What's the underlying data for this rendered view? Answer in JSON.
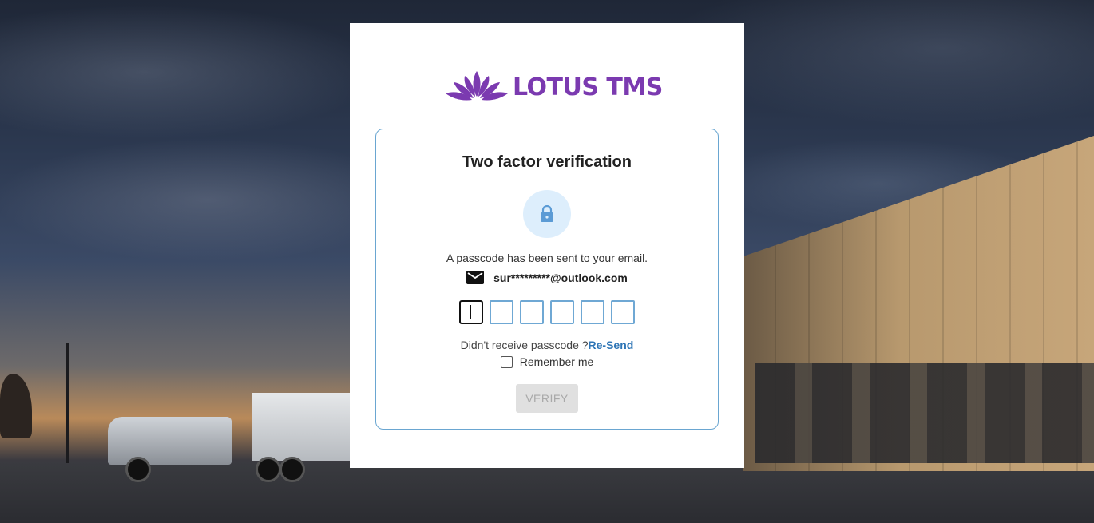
{
  "brand": {
    "name": "LOTUS TMS",
    "color": "#7b3ab0"
  },
  "verification": {
    "title": "Two factor verification",
    "message": "A passcode has been sent to your email.",
    "email": "sur*********@outlook.com",
    "code_digits": [
      "",
      "",
      "",
      "",
      "",
      ""
    ],
    "resend_prompt": "Didn't receive passcode ?",
    "resend_label": "Re-Send",
    "remember_label": "Remember me",
    "remember_checked": false,
    "verify_label": "VERIFY",
    "verify_enabled": false
  },
  "icons": {
    "lock": "lock-icon",
    "email": "mail-icon",
    "logo": "lotus-flower-icon"
  },
  "colors": {
    "accent": "#2f76b6",
    "input_border": "#6fa8d4",
    "lock_bg": "#ddeefc",
    "lock_icon": "#5b9bd5"
  }
}
